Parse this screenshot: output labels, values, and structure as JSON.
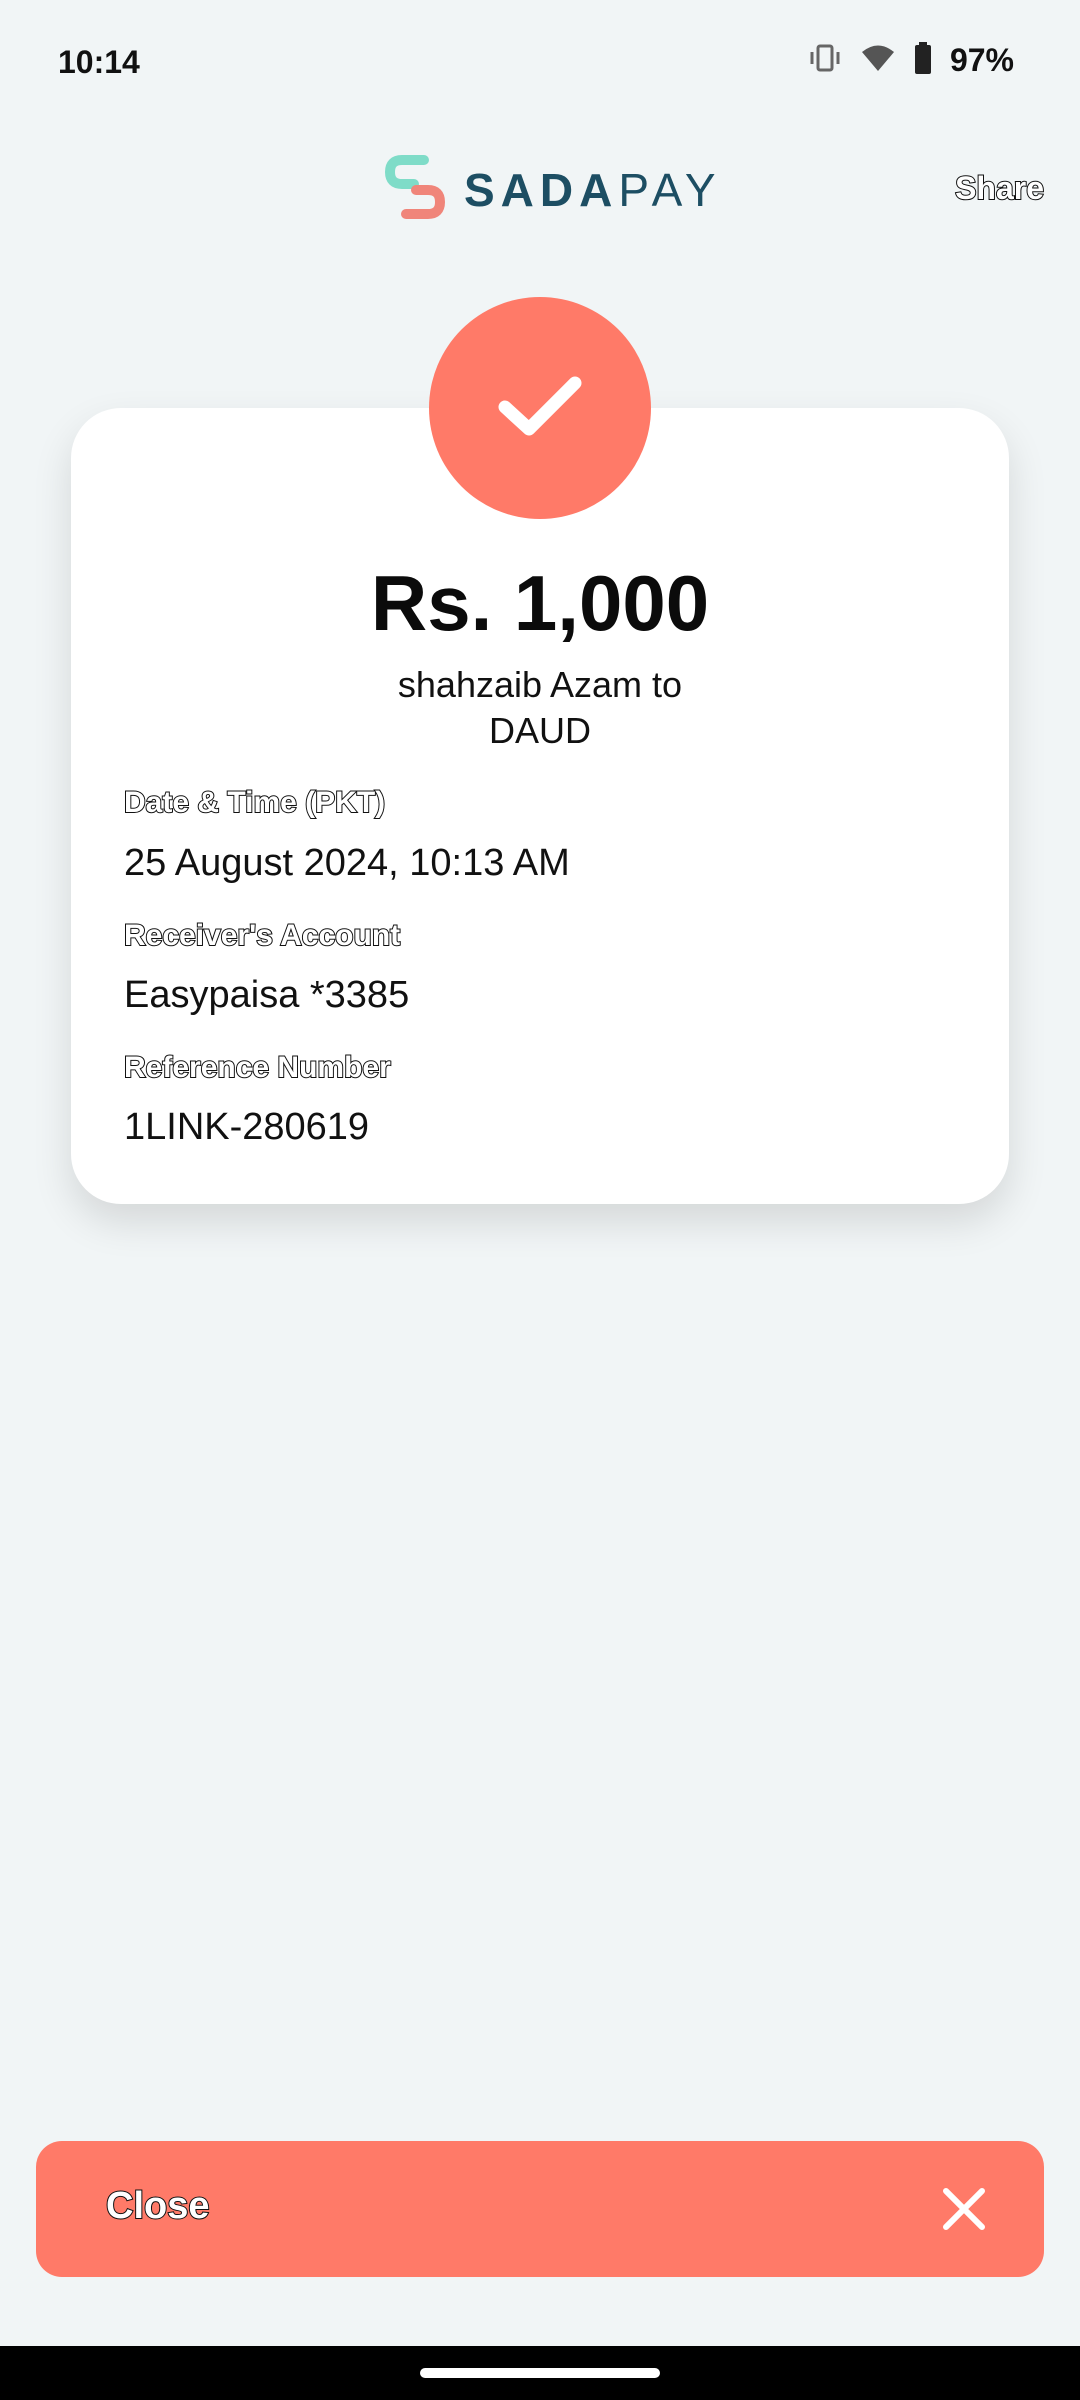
{
  "status_bar": {
    "time": "10:14",
    "battery": "97%",
    "icons": [
      "vibrate-icon",
      "wifi-icon",
      "battery-icon"
    ]
  },
  "header": {
    "logo_text_bold": "SADA",
    "logo_text_light": "PAY",
    "share_label": "Share"
  },
  "receipt": {
    "status_icon": "checkmark-icon",
    "amount": "Rs. 1,000",
    "sender_line": "shahzaib Azam to",
    "receiver_line": "DAUD",
    "fields": [
      {
        "label": "Date & Time (PKT)",
        "value": "25 August 2024, 10:13 AM"
      },
      {
        "label": "Receiver's Account",
        "value": "Easypaisa *3385"
      },
      {
        "label": "Reference Number",
        "value": "1LINK-280619"
      }
    ]
  },
  "footer": {
    "close_label": "Close",
    "close_icon": "close-icon"
  },
  "colors": {
    "accent": "#ff7a68",
    "brand": "#1d4e63",
    "background": "#f1f5f6"
  }
}
